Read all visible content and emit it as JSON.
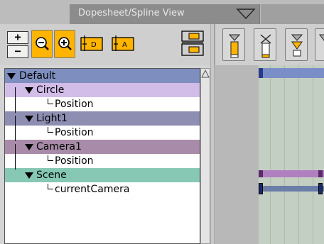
{
  "window": {
    "title": "Dopesheet/Spline View"
  },
  "toolbar": {
    "plus_label": "+",
    "minus_label": "−",
    "buttons": [
      {
        "name": "zoom-out",
        "icon": "zoom-out-icon"
      },
      {
        "name": "zoom-in",
        "icon": "zoom-in-icon"
      },
      {
        "name": "fit-d",
        "icon": "fit-d-icon",
        "text": "D"
      },
      {
        "name": "fit-a",
        "icon": "fit-a-icon",
        "text": "A"
      },
      {
        "name": "layout",
        "icon": "layout-icon"
      }
    ]
  },
  "tree": {
    "items": [
      {
        "label": "Default",
        "level": 0,
        "color": "#7e8fbf",
        "expanded": true
      },
      {
        "label": "Circle",
        "level": 1,
        "color": "#d2bce8",
        "expanded": true
      },
      {
        "label": "Position",
        "level": 2,
        "color": "#ffffff"
      },
      {
        "label": "Light1",
        "level": 1,
        "color": "#8e8eb2",
        "expanded": true
      },
      {
        "label": "Position",
        "level": 2,
        "color": "#ffffff"
      },
      {
        "label": "Camera1",
        "level": 1,
        "color": "#a88ba8",
        "expanded": true
      },
      {
        "label": "Position",
        "level": 2,
        "color": "#ffffff"
      },
      {
        "label": "Scene",
        "level": 1,
        "color": "#86c8b4",
        "expanded": true
      },
      {
        "label": "currentCamera",
        "level": 2,
        "color": "#ffffff"
      }
    ]
  },
  "colors": {
    "accent_orange": "#ffb400",
    "tab_bg": "#8c8c8c",
    "timeline_blue": "#7a8fc8",
    "timeline_purple": "#a05fa0"
  }
}
